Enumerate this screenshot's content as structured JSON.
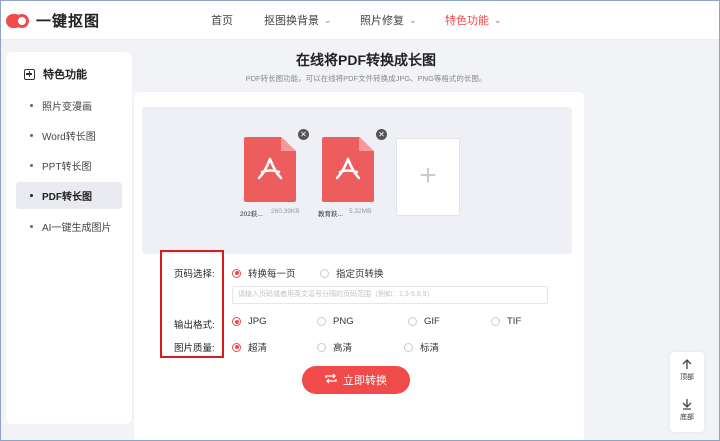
{
  "header": {
    "logo_text": "一键抠图",
    "nav": [
      {
        "label": "首页",
        "has_menu": false
      },
      {
        "label": "抠图换背景",
        "has_menu": true
      },
      {
        "label": "照片修复",
        "has_menu": true
      },
      {
        "label": "特色功能",
        "has_menu": true,
        "active": true
      }
    ]
  },
  "sidebar": {
    "title": "特色功能",
    "items": [
      {
        "label": "照片变漫画"
      },
      {
        "label": "Word转长图"
      },
      {
        "label": "PPT转长图"
      },
      {
        "label": "PDF转长图",
        "active": true
      },
      {
        "label": "AI一键生成图片"
      }
    ]
  },
  "main": {
    "title": "在线将PDF转换成长图",
    "subtitle": "PDF转长图功能，可以在线将PDF文件转换成JPG、PNG等格式的长图。",
    "files": [
      {
        "name": "202萩...",
        "size": "260.39KB"
      },
      {
        "name": "教育萩...",
        "size": "5.32MB"
      }
    ],
    "add_symbol": "+",
    "options": {
      "page_select": {
        "label": "页码选择:",
        "choices": [
          "转换每一页",
          "指定页转换"
        ],
        "selected": "转换每一页",
        "placeholder": "请输入页码或者用英文逗号分隔的页码范围（例如：1,3-5,8,9）"
      },
      "format": {
        "label": "输出格式:",
        "choices": [
          "JPG",
          "PNG",
          "GIF",
          "TIF"
        ],
        "selected": "JPG"
      },
      "quality": {
        "label": "图片质量:",
        "choices": [
          "超清",
          "高清",
          "标清"
        ],
        "selected": "超清"
      }
    },
    "convert_label": "立即转换"
  },
  "float_bar": {
    "top_label": "顶部",
    "bottom_label": "底部"
  },
  "colors": {
    "accent": "#f04a4a",
    "highlight_box": "#d81c1c"
  }
}
